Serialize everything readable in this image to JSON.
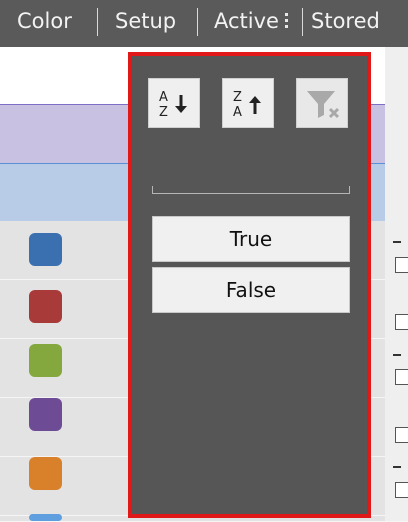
{
  "header": {
    "columns": [
      "Color",
      "Setup",
      "Active",
      "Stored"
    ]
  },
  "rows": [
    {
      "color": "#3a6fb0",
      "cut": "dash"
    },
    {
      "color": "#a83a3a",
      "cut": "check"
    },
    {
      "color": "#85a83e",
      "cut": "dash"
    },
    {
      "color": "#6e4c95",
      "cut": "check"
    },
    {
      "color": "#d8802a",
      "cut": "dash"
    }
  ],
  "filter_popup": {
    "sort_ascending_icon": "sort-a-z-icon",
    "sort_descending_icon": "sort-z-a-icon",
    "clear_filter_icon": "clear-filter-icon",
    "sort_ascending_glyph_top": "A",
    "sort_ascending_glyph_bottom": "Z",
    "sort_descending_glyph_top": "Z",
    "sort_descending_glyph_bottom": "A",
    "values": [
      "True",
      "False"
    ],
    "highlight_color": "#e01818"
  }
}
